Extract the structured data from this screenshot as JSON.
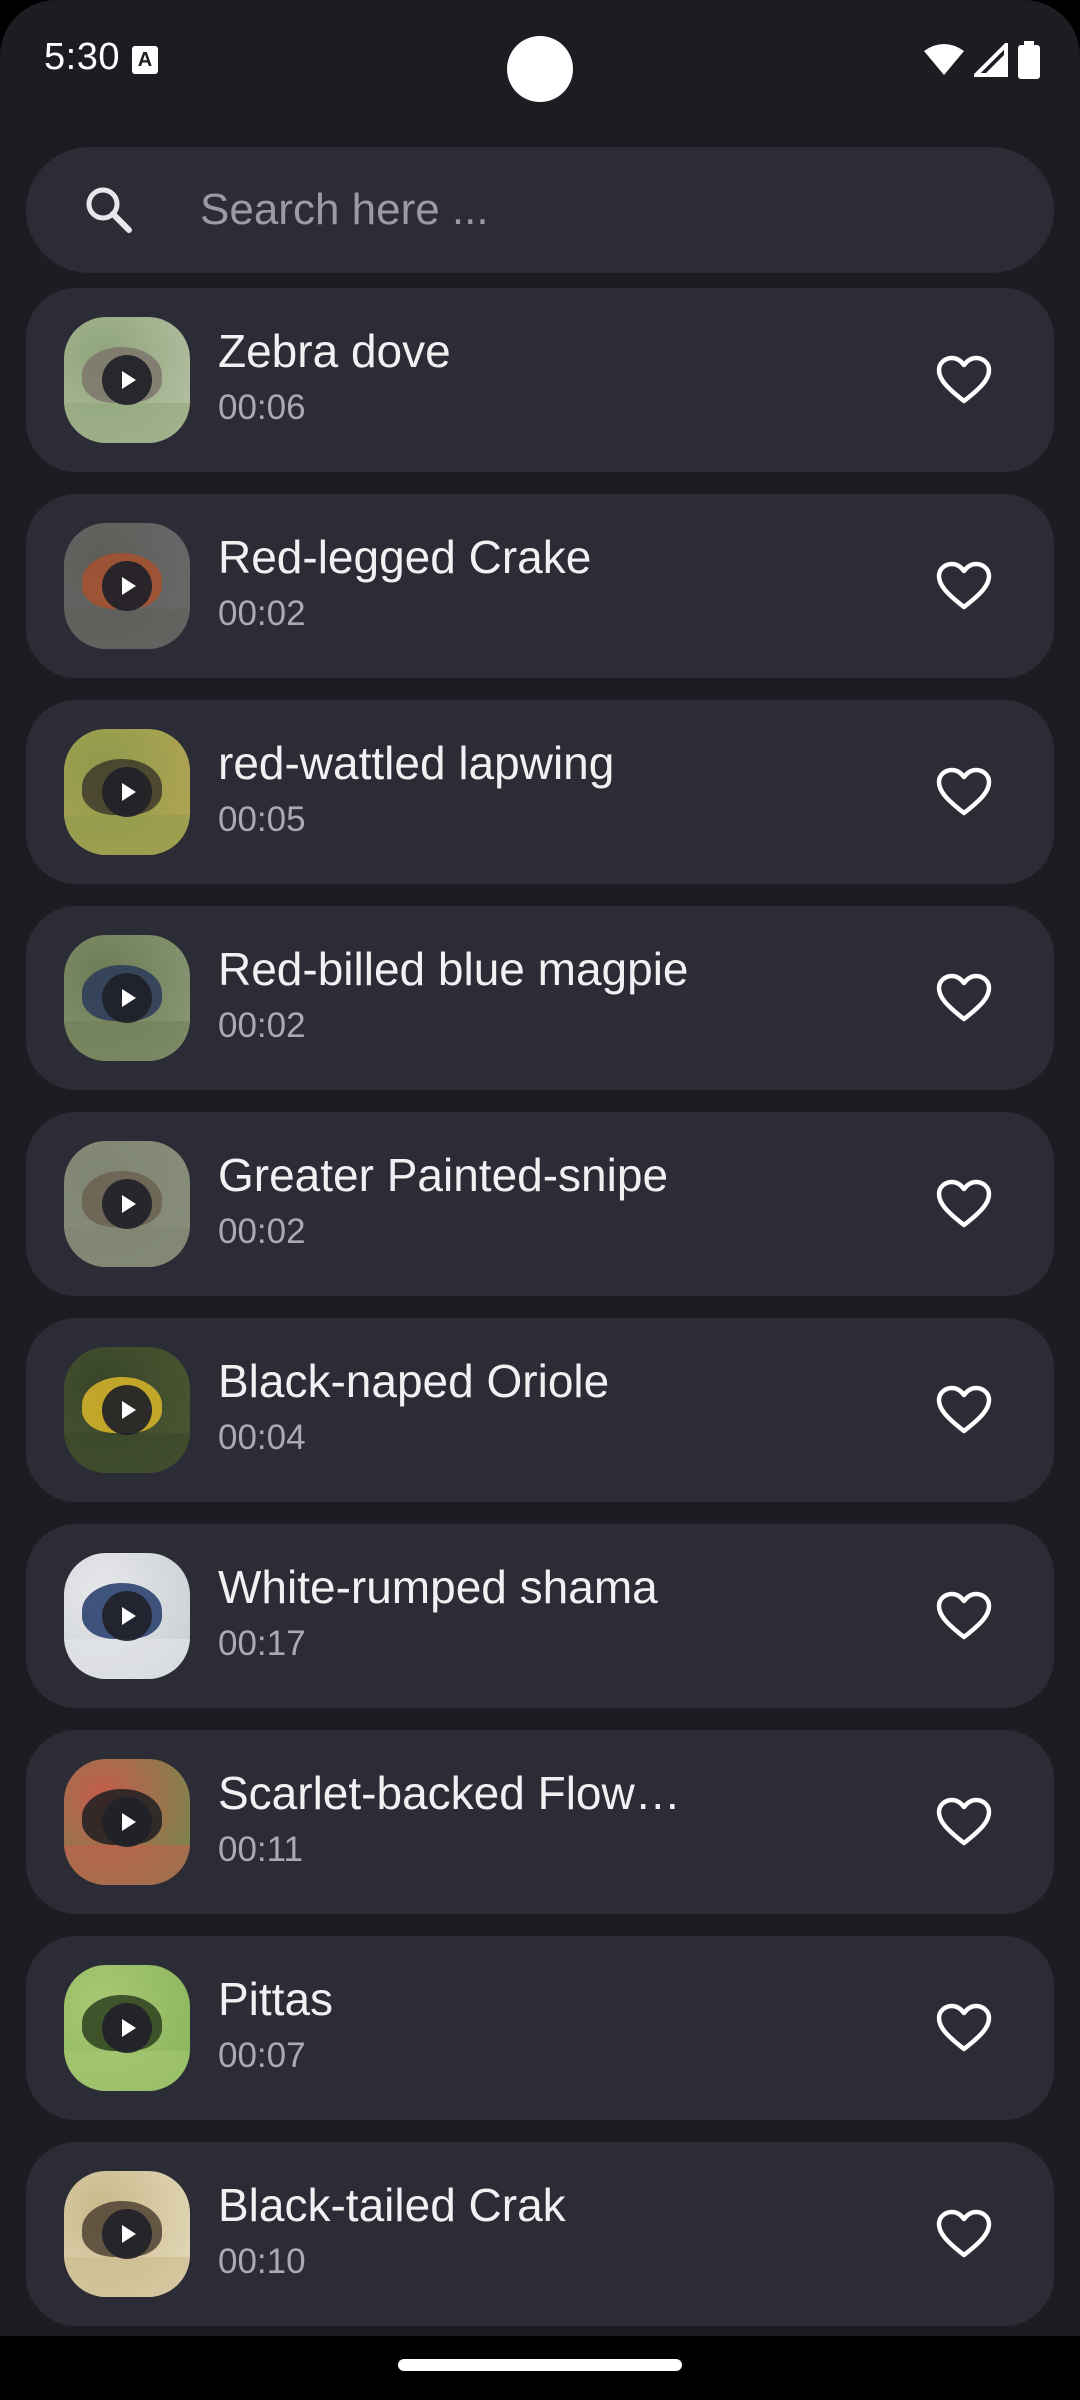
{
  "status_bar": {
    "time": "5:30",
    "notification_icon": "a-icon",
    "icons": [
      "wifi-icon",
      "signal-icon",
      "battery-icon"
    ]
  },
  "search": {
    "placeholder": "Search here ...",
    "value": ""
  },
  "colors": {
    "background": "#1c1d22",
    "card": "#2b2c35",
    "title_text": "#f1f1f4",
    "duration_text": "#a9aab3"
  },
  "sounds": [
    {
      "title": "Zebra dove",
      "duration": "00:06",
      "thumb_colors": [
        "#b9c3a8",
        "#7d766c",
        "#8fa57a"
      ]
    },
    {
      "title": "Red-legged Crake",
      "duration": "00:02",
      "thumb_colors": [
        "#6c6b6e",
        "#a7512f",
        "#5d5d58"
      ]
    },
    {
      "title": "red-wattled lapwing",
      "duration": "00:05",
      "thumb_colors": [
        "#b7a654",
        "#3d3a2a",
        "#8e9a4c"
      ]
    },
    {
      "title": "Red-billed blue magpie",
      "duration": "00:02",
      "thumb_colors": [
        "#8c9b79",
        "#2c3a5a",
        "#6f7d56"
      ]
    },
    {
      "title": "Greater Painted-snipe",
      "duration": "00:02",
      "thumb_colors": [
        "#8a8f7d",
        "#6b6151",
        "#7f8572"
      ]
    },
    {
      "title": "Black-naped Oriole",
      "duration": "00:04",
      "thumb_colors": [
        "#4d5a31",
        "#d9b62a",
        "#39452a"
      ]
    },
    {
      "title": "White-rumped shama",
      "duration": "00:17",
      "thumb_colors": [
        "#c7ccd0",
        "#223a6a",
        "#e6e7ea"
      ]
    },
    {
      "title": "Scarlet-backed Flow…",
      "duration": "00:11",
      "thumb_colors": [
        "#6c8d4e",
        "#1e1e22",
        "#c45c4c"
      ]
    },
    {
      "title": "Pittas",
      "duration": "00:07",
      "thumb_colors": [
        "#86b25a",
        "#2d3f1f",
        "#a8c874"
      ]
    },
    {
      "title": "Black-tailed Crak",
      "duration": "00:10",
      "thumb_colors": [
        "#e7dcbf",
        "#4f4232",
        "#c9b98b"
      ]
    }
  ]
}
